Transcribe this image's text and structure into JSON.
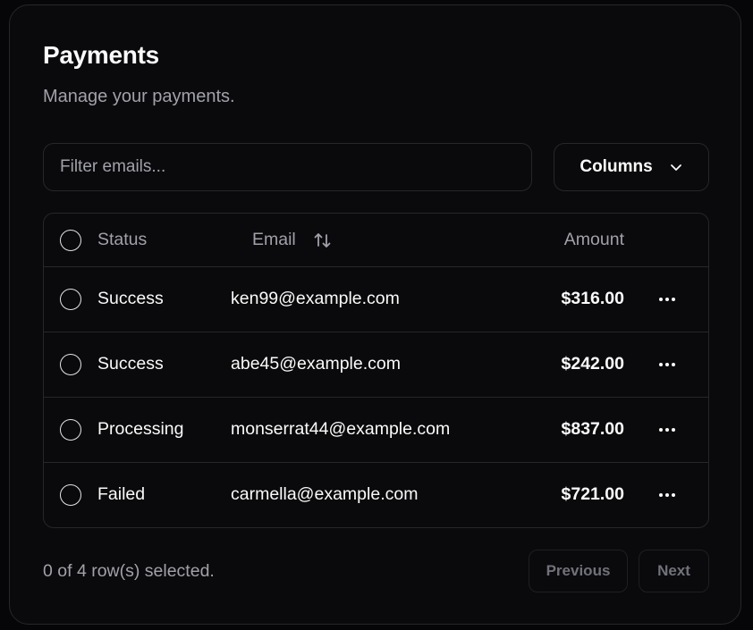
{
  "card": {
    "title": "Payments",
    "subtitle": "Manage your payments."
  },
  "toolbar": {
    "filter_placeholder": "Filter emails...",
    "filter_value": "",
    "columns_label": "Columns",
    "columns_icon": "chevron-down-icon"
  },
  "table": {
    "headers": {
      "status": "Status",
      "email": "Email",
      "amount": "Amount",
      "sort_icon": "sort-arrows-icon"
    },
    "rows": [
      {
        "status": "Success",
        "email": "ken99@example.com",
        "amount": "$316.00"
      },
      {
        "status": "Success",
        "email": "abe45@example.com",
        "amount": "$242.00"
      },
      {
        "status": "Processing",
        "email": "monserrat44@example.com",
        "amount": "$837.00"
      },
      {
        "status": "Failed",
        "email": "carmella@example.com",
        "amount": "$721.00"
      }
    ],
    "row_action_icon": "more-horizontal-icon"
  },
  "footer": {
    "selection_text": "0 of 4 row(s) selected.",
    "previous_label": "Previous",
    "next_label": "Next"
  },
  "colors": {
    "background": "#0a0a0c",
    "border": "#27272a",
    "text": "#fafafa",
    "muted_text": "#a1a1aa",
    "disabled_text": "#71717a"
  }
}
